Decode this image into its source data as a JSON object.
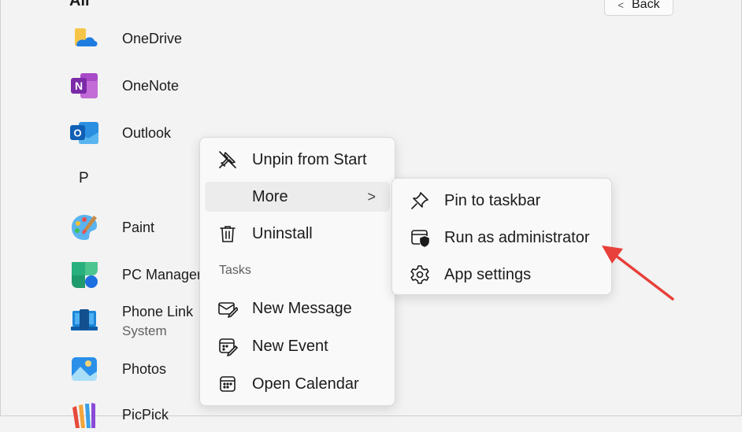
{
  "header": {
    "section": "All",
    "back_label": "Back",
    "back_glyph": "<"
  },
  "apps": [
    {
      "name": "OneDrive",
      "icon": "onedrive-icon"
    },
    {
      "name": "OneNote",
      "icon": "onenote-icon"
    },
    {
      "name": "Outlook",
      "icon": "outlook-icon"
    },
    {
      "name": "Paint",
      "icon": "paint-icon"
    },
    {
      "name": "PC Manager",
      "icon": "pc-manager-icon"
    },
    {
      "name": "Phone Link",
      "subtitle": "System",
      "icon": "phone-link-icon"
    },
    {
      "name": "Photos",
      "icon": "photos-icon"
    },
    {
      "name": "PicPick",
      "icon": "picpick-icon"
    }
  ],
  "letter_p": "P",
  "context_menu": {
    "items": [
      {
        "label": "Unpin from Start",
        "icon": "unpin-icon"
      },
      {
        "label": "More",
        "icon": "",
        "chevron": ">"
      },
      {
        "label": "Uninstall",
        "icon": "trash-icon"
      }
    ],
    "tasks_label": "Tasks",
    "tasks": [
      {
        "label": "New Message",
        "icon": "new-message-icon"
      },
      {
        "label": "New Event",
        "icon": "new-event-icon"
      },
      {
        "label": "Open Calendar",
        "icon": "calendar-icon"
      }
    ]
  },
  "submenu": {
    "items": [
      {
        "label": "Pin to taskbar",
        "icon": "pin-icon"
      },
      {
        "label": "Run as administrator",
        "icon": "shield-window-icon"
      },
      {
        "label": "App settings",
        "icon": "gear-icon"
      }
    ]
  },
  "colors": {
    "annotation_arrow": "#e8403a",
    "background": "#f3f3f3",
    "menu_bg": "#f9f9f9"
  }
}
